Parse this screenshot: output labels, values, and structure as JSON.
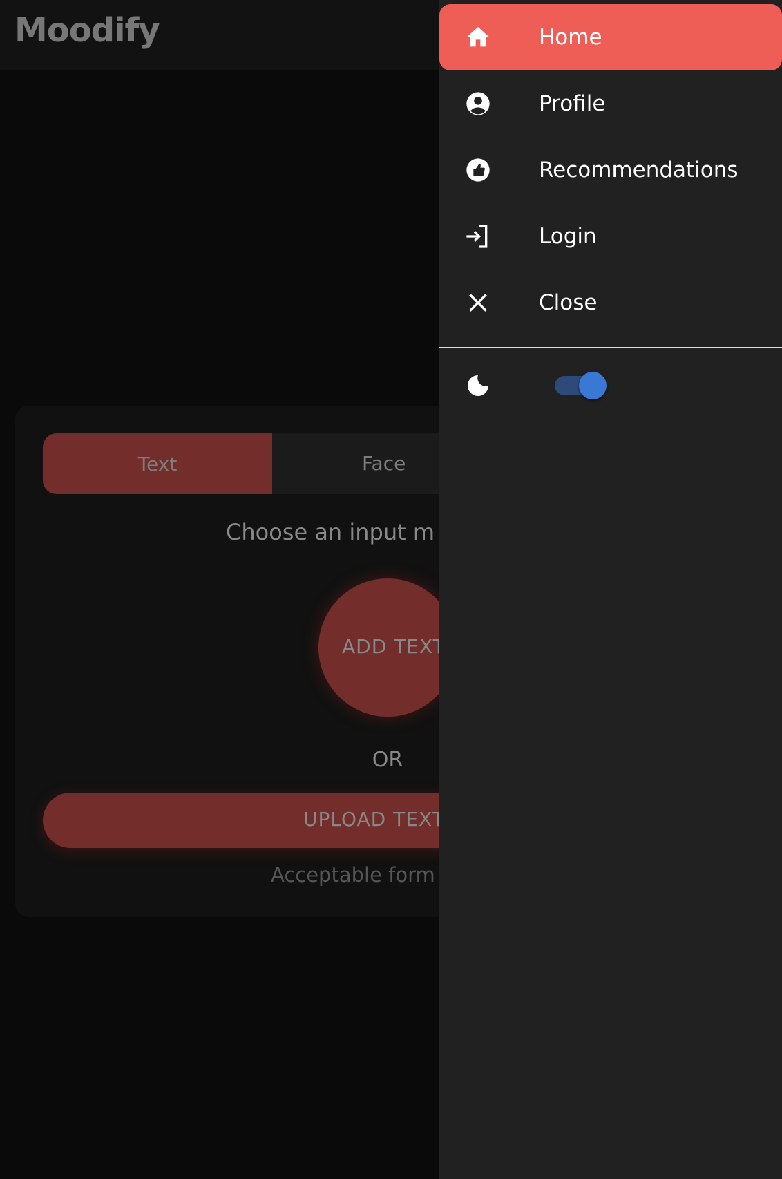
{
  "header": {
    "title": "Moodify"
  },
  "card": {
    "tabs": [
      {
        "label": "Text",
        "active": true
      },
      {
        "label": "Face",
        "active": false
      }
    ],
    "prompt": "Choose an input m",
    "add_button": "ADD TEXT",
    "or_label": "OR",
    "upload_button": "UPLOAD TEXT",
    "formats_note": "Acceptable form"
  },
  "drawer": {
    "items": [
      {
        "label": "Home",
        "icon": "home-icon",
        "active": true
      },
      {
        "label": "Profile",
        "icon": "account-circle-icon"
      },
      {
        "label": "Recommendations",
        "icon": "thumb-up-icon"
      },
      {
        "label": "Login",
        "icon": "login-icon"
      },
      {
        "label": "Close",
        "icon": "close-icon"
      }
    ],
    "dark_mode": {
      "icon": "moon-icon",
      "enabled": true
    }
  },
  "colors": {
    "accent": "#ef5d57",
    "switch": "#3a78d6",
    "drawer_bg": "#212121"
  }
}
